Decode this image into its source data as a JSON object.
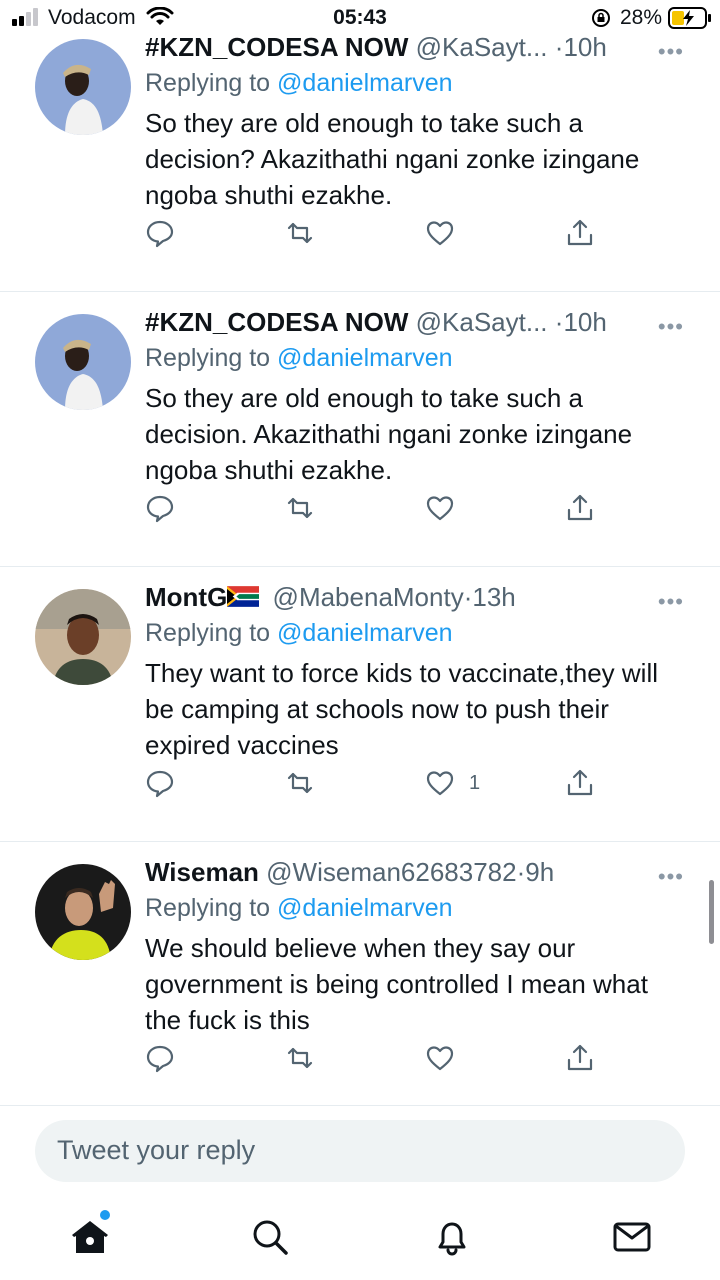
{
  "status_bar": {
    "carrier": "Vodacom",
    "time": "05:43",
    "battery": "28%"
  },
  "tweets": [
    {
      "name": "#KZN_CODESA NOW",
      "handle": "@KaSayt...",
      "dot": "·",
      "time": "10h",
      "replying_prefix": "Replying to",
      "replying_to": "@danielmarven",
      "text": "So they are old enough to take such a decision? Akazithathi ngani zonke izingane ngoba shuthi ezakhe.",
      "likes": ""
    },
    {
      "name": "#KZN_CODESA NOW",
      "handle": "@KaSayt...",
      "dot": "·",
      "time": "10h",
      "replying_prefix": "Replying to",
      "replying_to": "@danielmarven",
      "text": "So they are old enough to take such a decision. Akazithathi ngani zonke izingane ngoba shuthi ezakhe.",
      "likes": ""
    },
    {
      "name": "MontG",
      "handle": "@MabenaMonty",
      "dot": "·",
      "time": "13h",
      "replying_prefix": "Replying to",
      "replying_to": "@danielmarven",
      "text": "They want to force kids to vaccinate,they will be camping at schools now to push their expired vaccines",
      "likes": "1"
    },
    {
      "name": "Wiseman",
      "handle": "@Wiseman62683782",
      "dot": "·",
      "time": "9h",
      "replying_prefix": "Replying to",
      "replying_to": "@danielmarven",
      "text": "We should believe when they say our government is being controlled I mean what the fuck is this",
      "likes": ""
    }
  ],
  "reply_input": {
    "placeholder": "Tweet your reply"
  },
  "colors": {
    "accent": "#1d9bf0",
    "secondary_text": "#536471",
    "divider": "#e6ecf0",
    "input_bg": "#eff3f4"
  },
  "icons": {
    "tab_home": "home-icon",
    "tab_search": "search-icon",
    "tab_notifications": "bell-icon",
    "tab_messages": "mail-icon"
  }
}
